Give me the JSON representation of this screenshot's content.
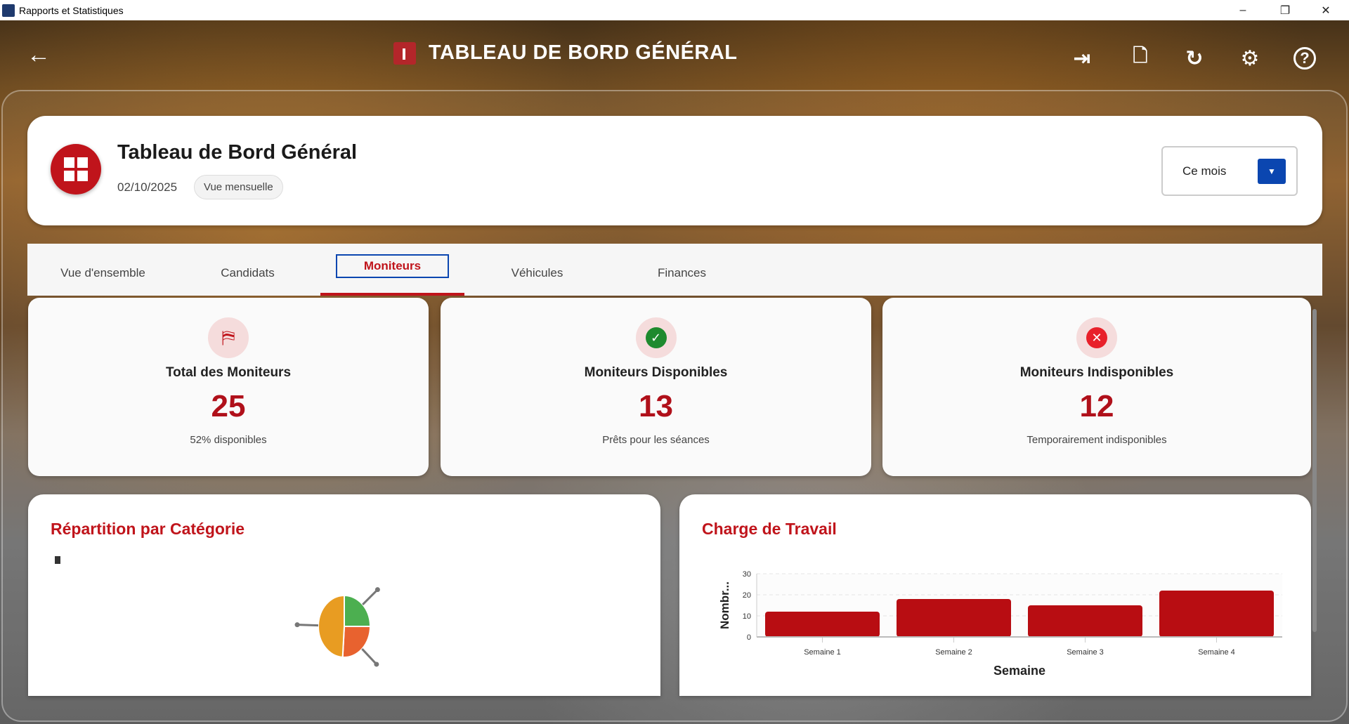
{
  "window": {
    "title": "Rapports et Statistiques",
    "minimize": "–",
    "maximize": "❐",
    "close": "✕"
  },
  "header": {
    "title": "TABLEAU DE BORD GÉNÉRAL",
    "back": "←",
    "icons": [
      "export-icon",
      "pdf-icon",
      "refresh-icon",
      "settings-icon",
      "help-icon"
    ]
  },
  "dashboard": {
    "title": "Tableau de Bord Général",
    "date": "02/10/2025",
    "view_chip": "Vue mensuelle",
    "period": "Ce mois"
  },
  "tabs": [
    {
      "label": "Vue d'ensemble"
    },
    {
      "label": "Candidats"
    },
    {
      "label": "Moniteurs",
      "active": true
    },
    {
      "label": "Véhicules"
    },
    {
      "label": "Finances"
    }
  ],
  "stats": [
    {
      "label": "Total des Moniteurs",
      "value": "25",
      "sub": "52% disponibles"
    },
    {
      "label": "Moniteurs Disponibles",
      "value": "13",
      "sub": "Prêts pour les séances"
    },
    {
      "label": "Moniteurs Indisponibles",
      "value": "12",
      "sub": "Temporairement indisponibles"
    }
  ],
  "colors": {
    "accent": "#c0141b",
    "primary": "#0b46b0",
    "success": "#2e9e3e"
  },
  "chart_data": [
    {
      "type": "pie",
      "title": "Répartition par Catégorie",
      "values": [
        25,
        26,
        49
      ],
      "colors": [
        "#4caf50",
        "#e8622f",
        "#e89c22"
      ]
    },
    {
      "type": "bar",
      "title": "Charge de Travail",
      "categories": [
        "Semaine 1",
        "Semaine 2",
        "Semaine 3",
        "Semaine 4"
      ],
      "values": [
        12,
        18,
        15,
        22
      ],
      "xlabel": "Semaine",
      "ylabel": "Nombr...",
      "ylim": [
        0,
        30
      ],
      "yticks": [
        "0",
        "10",
        "20",
        "30"
      ],
      "grid": true
    }
  ]
}
